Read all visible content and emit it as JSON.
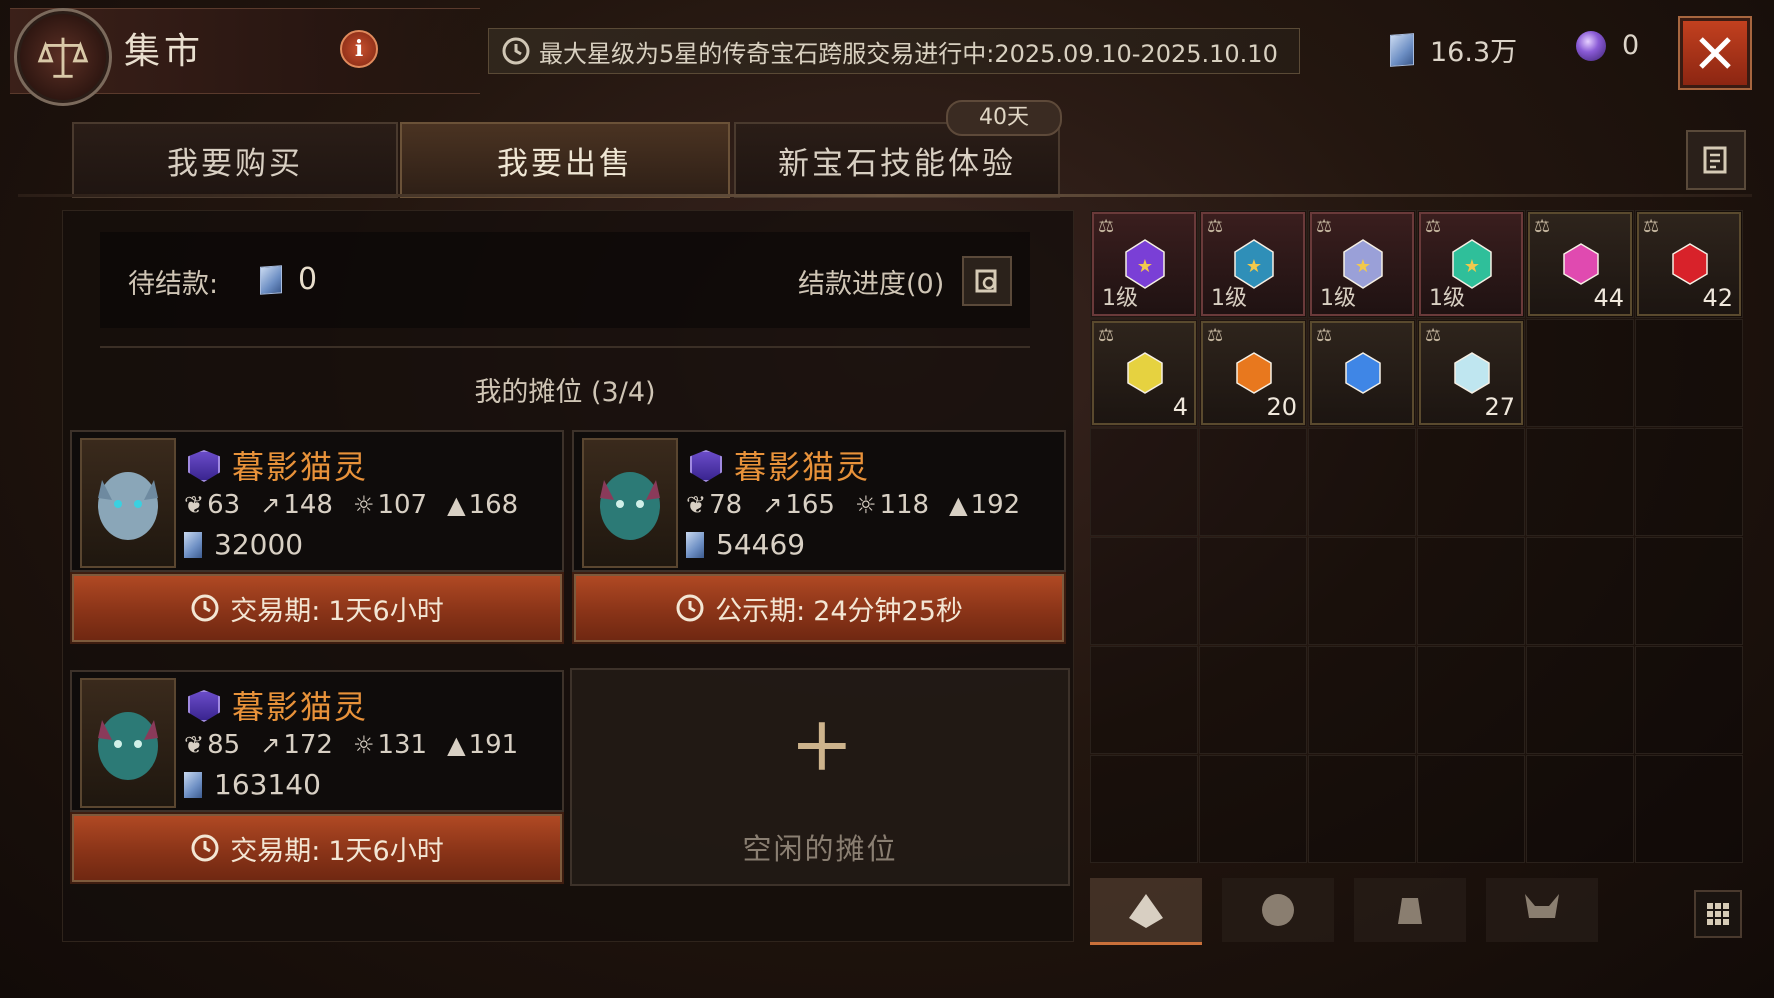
{
  "header": {
    "title": "集市",
    "info_label": "i",
    "notice": "最大星级为5星的传奇宝石跨服交易进行中:2025.09.10-2025.10.10",
    "currency_gems": "16.3万",
    "currency_orbs": "0",
    "close_icon": "close-icon"
  },
  "tabs": [
    {
      "label": "我要购买",
      "active": false
    },
    {
      "label": "我要出售",
      "active": true
    },
    {
      "label": "新宝石技能体验",
      "active": false,
      "badge": "40天"
    }
  ],
  "sell": {
    "pending_label": "待结款:",
    "pending_value": "0",
    "progress_label": "结款进度(0)",
    "slots_title": "我的摊位 (3/4)",
    "listings": [
      {
        "name": "暮影猫灵",
        "stats": [
          "63",
          "148",
          "107",
          "168"
        ],
        "price": "32000",
        "bar_label": "交易期:",
        "bar_time": "1天6小时"
      },
      {
        "name": "暮影猫灵",
        "stats": [
          "78",
          "165",
          "118",
          "192"
        ],
        "price": "54469",
        "bar_label": "公示期:",
        "bar_time": "24分钟25秒"
      },
      {
        "name": "暮影猫灵",
        "stats": [
          "85",
          "172",
          "131",
          "191"
        ],
        "price": "163140",
        "bar_label": "交易期:",
        "bar_time": "1天6小时"
      }
    ],
    "empty_slot_label": "空闲的摊位",
    "plus_symbol": "+"
  },
  "inventory": {
    "items": [
      {
        "kind": "legendary",
        "color": "#7a3fd6",
        "level": "1级",
        "qty": ""
      },
      {
        "kind": "legendary",
        "color": "#2f8fb8",
        "level": "1级",
        "qty": ""
      },
      {
        "kind": "legendary",
        "color": "#9aa0d8",
        "level": "1级",
        "qty": ""
      },
      {
        "kind": "legendary",
        "color": "#2fbf9a",
        "level": "1级",
        "qty": ""
      },
      {
        "kind": "gem",
        "color": "#e04ab0",
        "level": "",
        "qty": "44"
      },
      {
        "kind": "gem",
        "color": "#d8222a",
        "level": "",
        "qty": "42"
      },
      {
        "kind": "gem",
        "color": "#e6d240",
        "level": "",
        "qty": "4"
      },
      {
        "kind": "gem",
        "color": "#e8781e",
        "level": "",
        "qty": "20"
      },
      {
        "kind": "gem",
        "color": "#3f86e6",
        "level": "",
        "qty": ""
      },
      {
        "kind": "gem",
        "color": "#bfe6f0",
        "level": "",
        "qty": "27"
      }
    ],
    "bottom_tabs": [
      "gem-bag-icon",
      "rune-icon",
      "sack-icon",
      "demon-icon"
    ],
    "grid_icon": "grid-icon"
  },
  "colors": {
    "accent": "#e8923a",
    "bar": "#8a3418"
  }
}
